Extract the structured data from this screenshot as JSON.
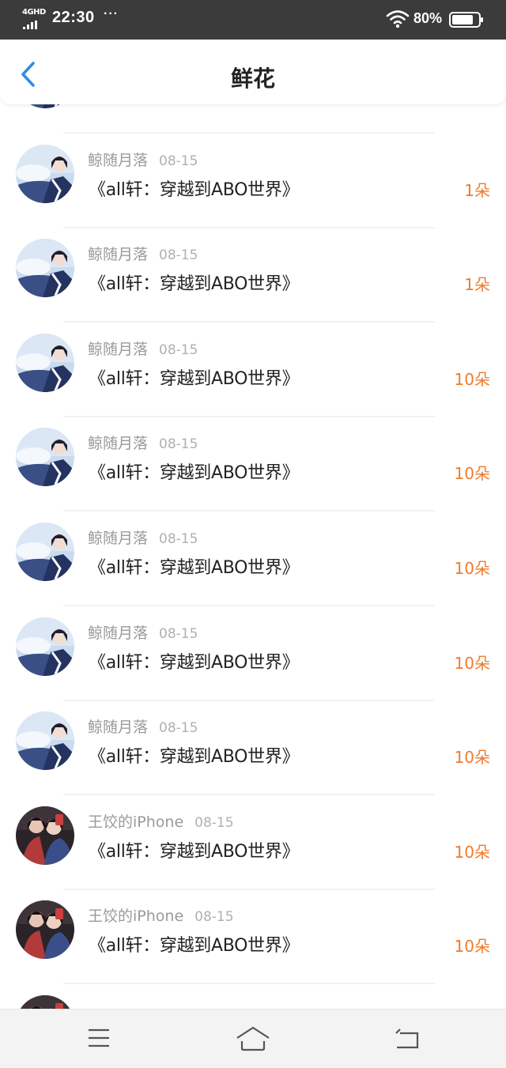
{
  "status_bar": {
    "network": "4GHD",
    "time": "22:30",
    "dots": "···",
    "battery": "80%"
  },
  "header": {
    "title": "鲜花"
  },
  "colors": {
    "count": "#ef7b2d",
    "back": "#2f8ee8",
    "status_bg": "#3b3b3b"
  },
  "items": [
    {
      "user": "鲸随月落",
      "date": "08-15",
      "title": "《all轩：穿越到ABO世界》",
      "count": "1朵",
      "avatar": "scene"
    },
    {
      "user": "鲸随月落",
      "date": "08-15",
      "title": "《all轩：穿越到ABO世界》",
      "count": "1朵",
      "avatar": "scene"
    },
    {
      "user": "鲸随月落",
      "date": "08-15",
      "title": "《all轩：穿越到ABO世界》",
      "count": "1朵",
      "avatar": "scene"
    },
    {
      "user": "鲸随月落",
      "date": "08-15",
      "title": "《all轩：穿越到ABO世界》",
      "count": "10朵",
      "avatar": "scene"
    },
    {
      "user": "鲸随月落",
      "date": "08-15",
      "title": "《all轩：穿越到ABO世界》",
      "count": "10朵",
      "avatar": "scene"
    },
    {
      "user": "鲸随月落",
      "date": "08-15",
      "title": "《all轩：穿越到ABO世界》",
      "count": "10朵",
      "avatar": "scene"
    },
    {
      "user": "鲸随月落",
      "date": "08-15",
      "title": "《all轩：穿越到ABO世界》",
      "count": "10朵",
      "avatar": "scene"
    },
    {
      "user": "鲸随月落",
      "date": "08-15",
      "title": "《all轩：穿越到ABO世界》",
      "count": "10朵",
      "avatar": "scene"
    },
    {
      "user": "王饺的iPhone",
      "date": "08-15",
      "title": "《all轩：穿越到ABO世界》",
      "count": "10朵",
      "avatar": "pair"
    },
    {
      "user": "王饺的iPhone",
      "date": "08-15",
      "title": "《all轩：穿越到ABO世界》",
      "count": "10朵",
      "avatar": "pair"
    },
    {
      "user": "",
      "date": "",
      "title": "",
      "count": "",
      "avatar": "pair"
    }
  ],
  "bottom_nav": {
    "icons": [
      "menu-icon",
      "home-icon",
      "back-arrow-icon"
    ]
  }
}
